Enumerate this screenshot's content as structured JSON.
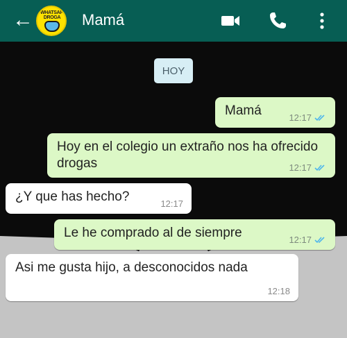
{
  "header": {
    "back_glyph": "←",
    "contact_name": "Mamá",
    "avatar_text": "WHATSAPP DROGA",
    "icons": [
      "video-call-icon",
      "phone-icon",
      "more-options-icon"
    ],
    "bg_color": "#075e54"
  },
  "date_chip": "HOY",
  "messages": [
    {
      "direction": "out",
      "text": "Mamá",
      "time": "12:17",
      "status": "read"
    },
    {
      "direction": "out",
      "text": "Hoy en el colegio un extraño nos ha ofrecido drogas",
      "time": "12:17",
      "status": "read"
    },
    {
      "direction": "in",
      "text": "¿Y que has hecho?",
      "time": "12:17"
    },
    {
      "direction": "out",
      "text": "Le he comprado al de siempre",
      "time": "12:17",
      "status": "read"
    },
    {
      "direction": "in",
      "text": "Asi me gusta hijo, a desconocidos nada",
      "time": "12:18"
    }
  ],
  "colors": {
    "outgoing_bubble": "#dcf8c6",
    "incoming_bubble": "#ffffff",
    "read_ticks": "#4fb6ec",
    "chat_background": "#0b0b0b"
  }
}
